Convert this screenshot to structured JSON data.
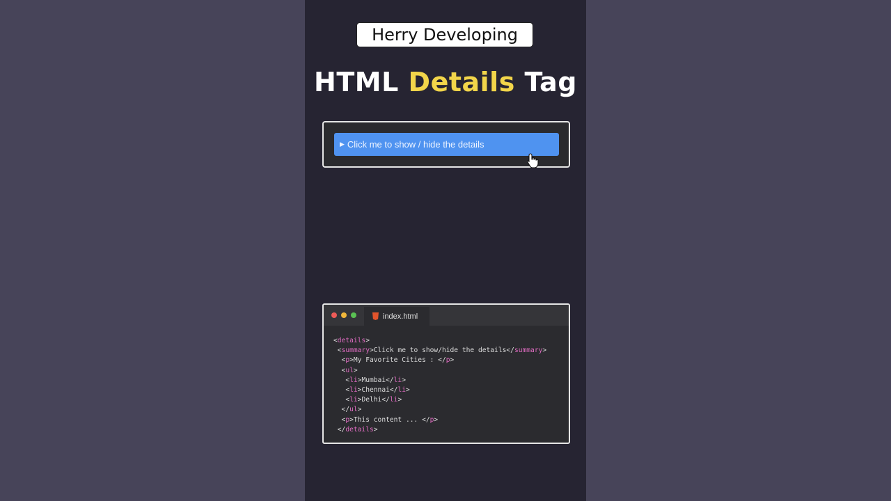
{
  "channel": {
    "name": "Herry Developing"
  },
  "title": {
    "part1": "HTML ",
    "accent": "Details",
    "part2": " Tag"
  },
  "demo": {
    "summary_label": "Click me to show / hide the details",
    "triangle": "▶"
  },
  "editor": {
    "tab_name": "index.html",
    "lines": [
      [
        [
          "p",
          "<"
        ],
        [
          "t",
          "details"
        ],
        [
          "p",
          ">"
        ]
      ],
      [
        [
          "p",
          " <"
        ],
        [
          "t",
          "summary"
        ],
        [
          "p",
          ">Click me to show/hide the details</"
        ],
        [
          "t",
          "summary"
        ],
        [
          "p",
          ">"
        ]
      ],
      [
        [
          "p",
          "  <"
        ],
        [
          "t",
          "p"
        ],
        [
          "p",
          ">My Favorite Cities : </"
        ],
        [
          "t",
          "p"
        ],
        [
          "p",
          ">"
        ]
      ],
      [
        [
          "p",
          "  <"
        ],
        [
          "t",
          "ul"
        ],
        [
          "p",
          ">"
        ]
      ],
      [
        [
          "p",
          "   <"
        ],
        [
          "t",
          "li"
        ],
        [
          "p",
          ">Mumbai</"
        ],
        [
          "t",
          "li"
        ],
        [
          "p",
          ">"
        ]
      ],
      [
        [
          "p",
          "   <"
        ],
        [
          "t",
          "li"
        ],
        [
          "p",
          ">Chennai</"
        ],
        [
          "t",
          "li"
        ],
        [
          "p",
          ">"
        ]
      ],
      [
        [
          "p",
          "   <"
        ],
        [
          "t",
          "li"
        ],
        [
          "p",
          ">Delhi</"
        ],
        [
          "t",
          "li"
        ],
        [
          "p",
          ">"
        ]
      ],
      [
        [
          "p",
          "  </"
        ],
        [
          "t",
          "ul"
        ],
        [
          "p",
          ">"
        ]
      ],
      [
        [
          "p",
          "  <"
        ],
        [
          "t",
          "p"
        ],
        [
          "p",
          ">This content ... </"
        ],
        [
          "t",
          "p"
        ],
        [
          "p",
          ">"
        ]
      ],
      [
        [
          "p",
          " </"
        ],
        [
          "t",
          "details"
        ],
        [
          "p",
          ">"
        ]
      ]
    ]
  },
  "colors": {
    "background": "#474459",
    "panel": "#262432",
    "accent": "#f2d54a",
    "summary": "#4f93f0",
    "tag": "#e06cc2"
  }
}
